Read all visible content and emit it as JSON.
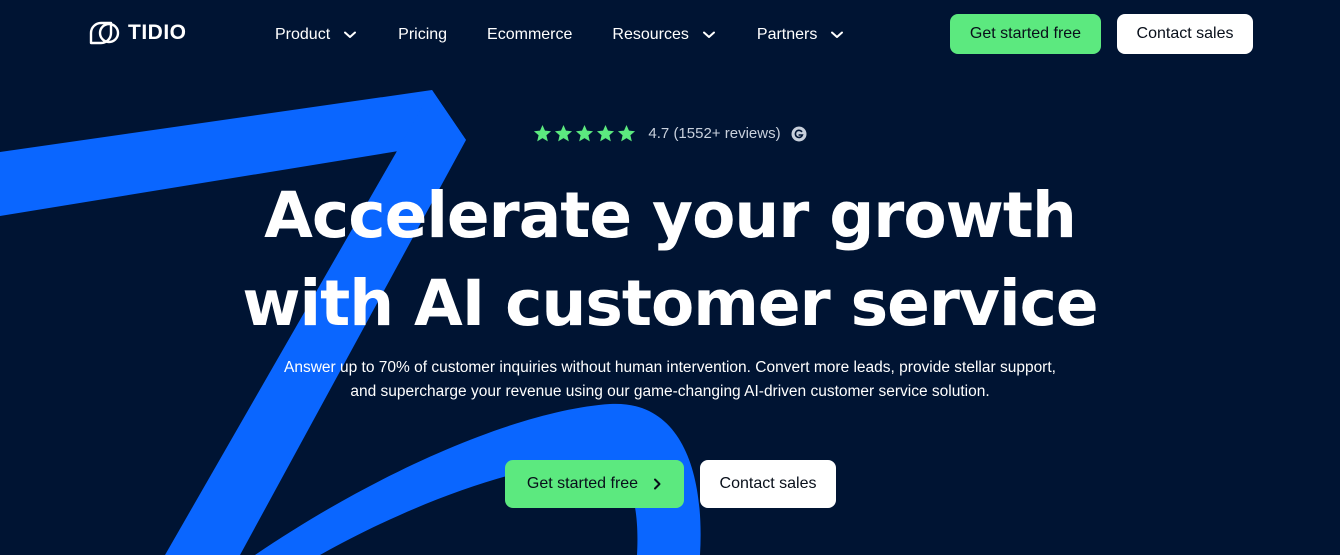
{
  "colors": {
    "background": "#001433",
    "accent_green": "#5ce97f",
    "swoosh_blue": "#0a66ff",
    "star_green": "#5ce97f"
  },
  "brand": {
    "name": "TIDIO",
    "logo_icon": "tidio-logo-icon"
  },
  "nav": {
    "items": [
      {
        "label": "Product",
        "has_dropdown": true
      },
      {
        "label": "Pricing",
        "has_dropdown": false
      },
      {
        "label": "Ecommerce",
        "has_dropdown": false
      },
      {
        "label": "Resources",
        "has_dropdown": true
      },
      {
        "label": "Partners",
        "has_dropdown": true
      }
    ],
    "cta_primary": "Get started free",
    "cta_secondary": "Contact sales"
  },
  "hero": {
    "rating": {
      "stars": 5,
      "score_text": "4.7 (1552+ reviews)",
      "source_icon": "g2-icon"
    },
    "headline_line1": "Accelerate your growth",
    "headline_line2": "with AI customer service",
    "subtext": "Answer up to 70% of customer inquiries without human intervention. Convert more leads, provide stellar support, and supercharge your revenue using our game-changing AI-driven customer service solution.",
    "cta_primary": "Get started free",
    "cta_secondary": "Contact sales"
  }
}
